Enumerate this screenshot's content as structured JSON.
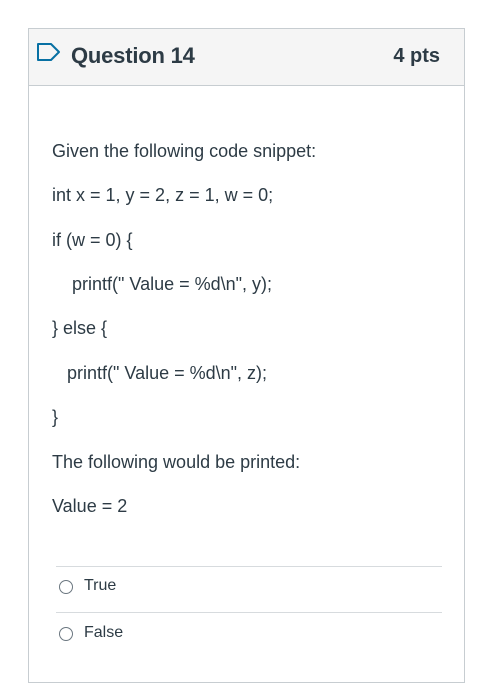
{
  "question": {
    "title": "Question 14",
    "points": "4 pts",
    "prompt_lines": [
      "Given the following code snippet:",
      "int x = 1, y = 2, z = 1, w = 0;",
      "if (w = 0) {",
      "printf(\" Value = %d\\n\", y);",
      "} else {",
      "printf(\" Value = %d\\n\", z);",
      "}",
      "The following would be printed:",
      "Value = 2"
    ],
    "answers": [
      {
        "label": "True"
      },
      {
        "label": "False"
      }
    ]
  },
  "icons": {
    "flag": "bookmark-flag-icon",
    "radio": "radio-button-icon"
  },
  "colors": {
    "accent_blue": "#0770a3",
    "text": "#2d3b45",
    "header_bg": "#f5f5f5",
    "border": "#c7cdd1"
  }
}
